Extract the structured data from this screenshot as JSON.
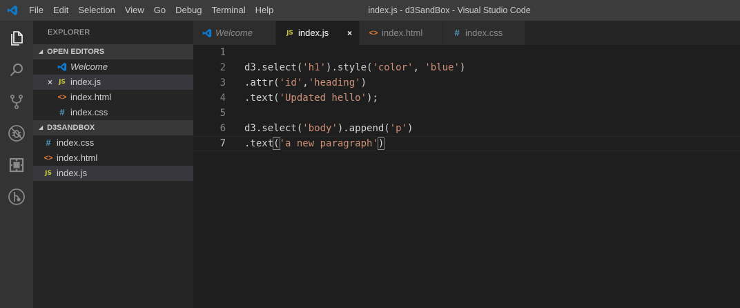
{
  "window": {
    "title": "index.js - d3SandBox - Visual Studio Code"
  },
  "menu": [
    "File",
    "Edit",
    "Selection",
    "View",
    "Go",
    "Debug",
    "Terminal",
    "Help"
  ],
  "activity_bar": [
    "files-icon",
    "search-icon",
    "source-control-icon",
    "debug-icon",
    "extensions-icon",
    "git-history-icon"
  ],
  "sidebar": {
    "title": "EXPLORER",
    "open_editors_header": "OPEN EDITORS",
    "open_editors": [
      {
        "icon": "vscode-icon",
        "label": "Welcome"
      },
      {
        "icon": "JS",
        "label": "index.js",
        "close": "×"
      },
      {
        "icon": "<>",
        "label": "index.html"
      },
      {
        "icon": "#",
        "label": "index.css"
      }
    ],
    "project_header": "D3SANDBOX",
    "files": [
      {
        "icon": "#",
        "label": "index.css"
      },
      {
        "icon": "<>",
        "label": "index.html"
      },
      {
        "icon": "JS",
        "label": "index.js"
      }
    ]
  },
  "tabs": [
    {
      "icon": "vscode-icon",
      "label": "Welcome"
    },
    {
      "icon": "JS",
      "label": "index.js",
      "close": "×"
    },
    {
      "icon": "<>",
      "label": "index.html"
    },
    {
      "icon": "#",
      "label": "index.css"
    }
  ],
  "editor": {
    "line_numbers": [
      "1",
      "2",
      "3",
      "4",
      "5",
      "6",
      "7"
    ],
    "lines": [
      {
        "tokens": []
      },
      {
        "tokens": [
          [
            "p",
            "d3.select("
          ],
          [
            "s",
            "'h1'"
          ],
          [
            "p",
            ").style("
          ],
          [
            "s",
            "'color'"
          ],
          [
            "p",
            ", "
          ],
          [
            "s",
            "'blue'"
          ],
          [
            "p",
            ")"
          ]
        ]
      },
      {
        "tokens": [
          [
            "p",
            ".attr("
          ],
          [
            "s",
            "'id'"
          ],
          [
            "p",
            ","
          ],
          [
            "s",
            "'heading'"
          ],
          [
            "p",
            ")"
          ]
        ]
      },
      {
        "tokens": [
          [
            "p",
            ".text("
          ],
          [
            "s",
            "'Updated hello'"
          ],
          [
            "p",
            ");"
          ]
        ]
      },
      {
        "tokens": []
      },
      {
        "tokens": [
          [
            "p",
            "d3.select("
          ],
          [
            "s",
            "'body'"
          ],
          [
            "p",
            ").append("
          ],
          [
            "s",
            "'p'"
          ],
          [
            "p",
            ")"
          ]
        ]
      },
      {
        "tokens": [
          [
            "p",
            ".text"
          ],
          [
            "b",
            "("
          ],
          [
            "s",
            "'a new paragraph'"
          ],
          [
            "b",
            ")"
          ]
        ]
      }
    ]
  },
  "colors": {
    "accent": "#007acc",
    "string": "#ce9178",
    "js_icon": "#cbcb41",
    "html_icon": "#e37933",
    "css_icon": "#519aba"
  }
}
